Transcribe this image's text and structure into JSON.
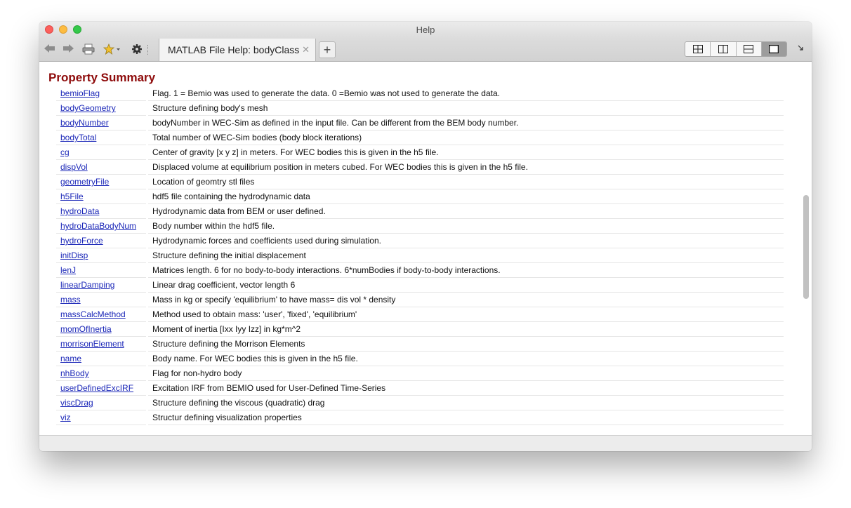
{
  "window": {
    "title": "Help"
  },
  "toolbar": {
    "back_icon": "arrow-left",
    "forward_icon": "arrow-right",
    "print_icon": "printer",
    "favorites_icon": "star-dropdown",
    "settings_icon": "gear",
    "tab": {
      "label": "MATLAB File Help: bodyClass",
      "close": "✕"
    },
    "new_tab_label": "+",
    "layout_buttons": [
      "layout-grid",
      "layout-columns",
      "layout-rows",
      "layout-single"
    ],
    "expand_icon": "expand"
  },
  "content": {
    "heading": "Property Summary",
    "properties": [
      {
        "name": "bemioFlag",
        "description": "Flag. 1 = Bemio was used to generate the data. 0 =Bemio was not used to generate the data."
      },
      {
        "name": "bodyGeometry",
        "description": "Structure defining body's mesh"
      },
      {
        "name": "bodyNumber",
        "description": "bodyNumber in WEC-Sim as defined in the input file. Can be different from the BEM body number."
      },
      {
        "name": "bodyTotal",
        "description": "Total number of WEC-Sim bodies (body block iterations)"
      },
      {
        "name": "cg",
        "description": "Center of gravity [x y z] in meters. For WEC bodies this is given in the h5 file."
      },
      {
        "name": "dispVol",
        "description": "Displaced volume at equilibrium position in meters cubed. For WEC bodies this is given in the h5 file."
      },
      {
        "name": "geometryFile",
        "description": "Location of geomtry stl files"
      },
      {
        "name": "h5File",
        "description": "hdf5 file containing the hydrodynamic data"
      },
      {
        "name": "hydroData",
        "description": "Hydrodynamic data from BEM or user defined."
      },
      {
        "name": "hydroDataBodyNum",
        "description": "Body number within the hdf5 file."
      },
      {
        "name": "hydroForce",
        "description": "Hydrodynamic forces and coefficients used during simulation."
      },
      {
        "name": "initDisp",
        "description": "Structure defining the initial displacement"
      },
      {
        "name": "lenJ",
        "description": "Matrices length. 6 for no body-to-body interactions. 6*numBodies if body-to-body interactions."
      },
      {
        "name": "linearDamping",
        "description": "Linear drag coefficient, vector length 6"
      },
      {
        "name": "mass",
        "description": "Mass in kg or specify 'equilibrium' to have mass= dis vol * density"
      },
      {
        "name": "massCalcMethod",
        "description": "Method used to obtain mass: 'user', 'fixed', 'equilibrium'"
      },
      {
        "name": "momOfInertia",
        "description": "Moment of inertia [Ixx Iyy Izz] in kg*m^2"
      },
      {
        "name": "morrisonElement",
        "description": "Structure defining the Morrison Elements"
      },
      {
        "name": "name",
        "description": "Body name. For WEC bodies this is given in the h5 file."
      },
      {
        "name": "nhBody",
        "description": "Flag for non-hydro body"
      },
      {
        "name": "userDefinedExcIRF",
        "description": "Excitation IRF from BEMIO used for User-Defined Time-Series"
      },
      {
        "name": "viscDrag",
        "description": "Structure defining the viscous (quadratic) drag"
      },
      {
        "name": "viz",
        "description": "Structur defining visualization properties"
      }
    ]
  },
  "colors": {
    "heading": "#8e0b0b",
    "link": "#1b27b8"
  }
}
